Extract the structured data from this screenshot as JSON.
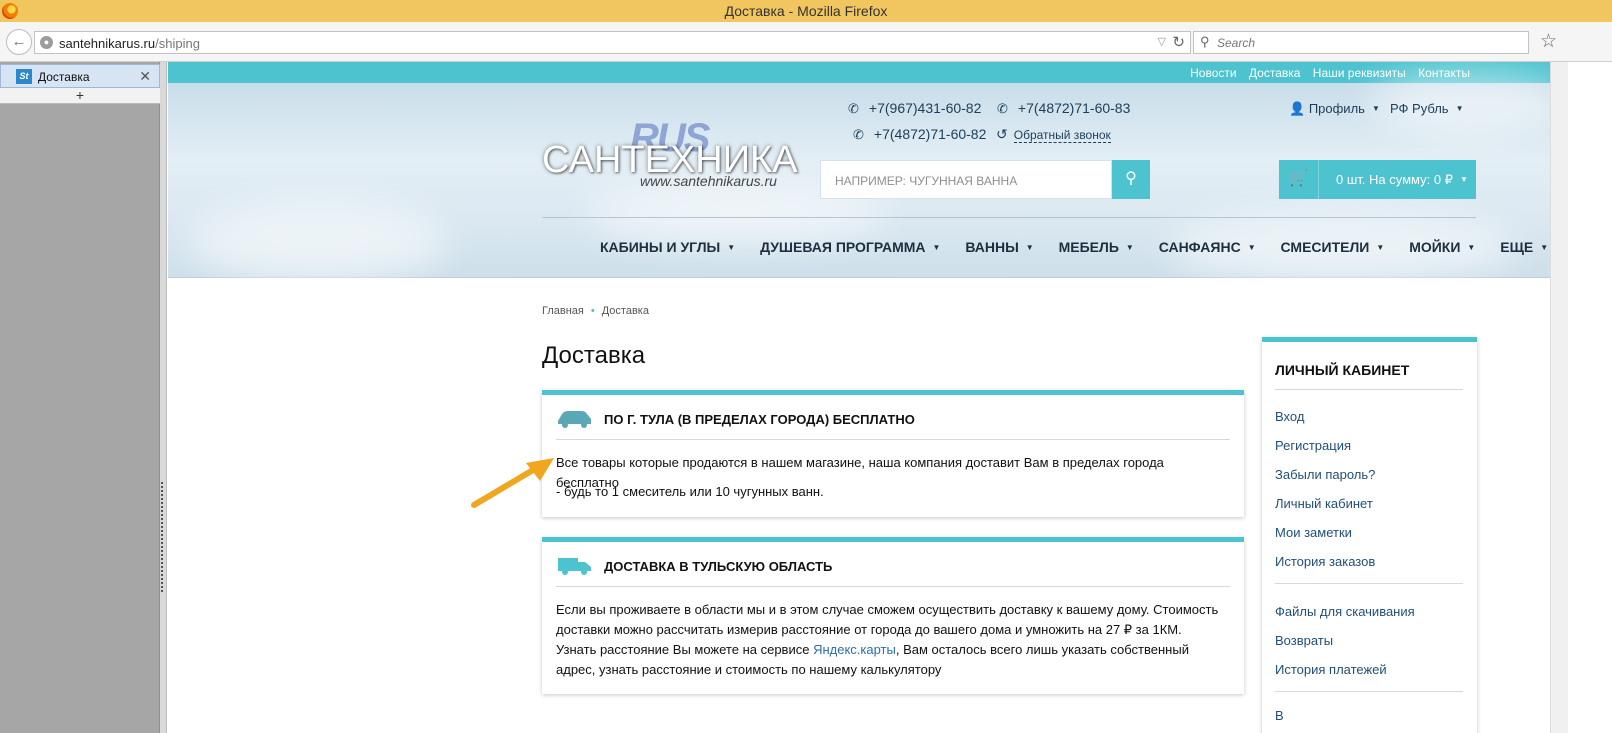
{
  "browser": {
    "window_title": "Доставка - Mozilla Firefox",
    "url_domain": "santehnikarus.ru",
    "url_path": "/shiping",
    "search_placeholder": "Search",
    "sidebar_tab_label": "Доставка",
    "sidebar_tab_favicon": "St",
    "new_tab_symbol": "+"
  },
  "site": {
    "top_links": [
      "Новости",
      "Доставка",
      "Наши реквизиты",
      "Контакты"
    ],
    "logo": {
      "overlay": "RUS",
      "main": "САНТЕХНИКА",
      "site": "www.santehnikarus.ru"
    },
    "phones": [
      "+7(967)431-60-82",
      "+7(4872)71-60-83",
      "+7(4872)71-60-82"
    ],
    "callback": "Обратный звонок",
    "profile": "Профиль",
    "currency": "РФ Рубль",
    "search_placeholder": "НАПРИМЕР: ЧУГУННАЯ ВАННА",
    "cart": "0 шт. На сумму: 0 ₽",
    "nav": [
      "КАБИНЫ И УГЛЫ",
      "ДУШЕВАЯ ПРОГРАММА",
      "ВАННЫ",
      "МЕБЕЛЬ",
      "САНФАЯНС",
      "СМЕСИТЕЛИ",
      "МОЙКИ",
      "ЕЩЕ"
    ],
    "colors": {
      "accent": "#4cc3cf",
      "link": "#1f4f79"
    }
  },
  "breadcrumb": [
    "Главная",
    "Доставка"
  ],
  "page_title": "Доставка",
  "cards": [
    {
      "heading": "ПО Г. ТУЛА (В ПРЕДЕЛАХ ГОРОДА) БЕСПЛАТНО",
      "text": "Все товары которые продаются в нашем магазине, наша компания доставит Вам в пределах города бесплатно",
      "note": "- будь то 1 смеситель или 10 чугунных ванн."
    },
    {
      "heading": "ДОСТАВКА В ТУЛЬСКУЮ ОБЛАСТЬ",
      "p1": "Если вы проживаете в области мы и в этом случае сможем осуществить доставку к вашему дому. Стоимость доставки можно рассчитать измерив расстояние от города до вашего дома и умножить на 27 ₽ за 1КМ.",
      "p2_before": "Узнать расстояние Вы можете на сервисе ",
      "p2_link": "Яндекс.карты",
      "p2_after": ", Вам осталось всего лишь указать собственный адрес, узнать расстояние и стоимость по нашему калькулятору"
    }
  ],
  "cabinet": {
    "title": "ЛИЧНЫЙ КАБИНЕТ",
    "group1": [
      "Вход",
      "Регистрация",
      "Забыли пароль?",
      "Личный кабинет",
      "Мои заметки",
      "История заказов"
    ],
    "group2": [
      "Файлы для скачивания",
      "Возвраты",
      "История платежей"
    ],
    "partial": "В"
  }
}
